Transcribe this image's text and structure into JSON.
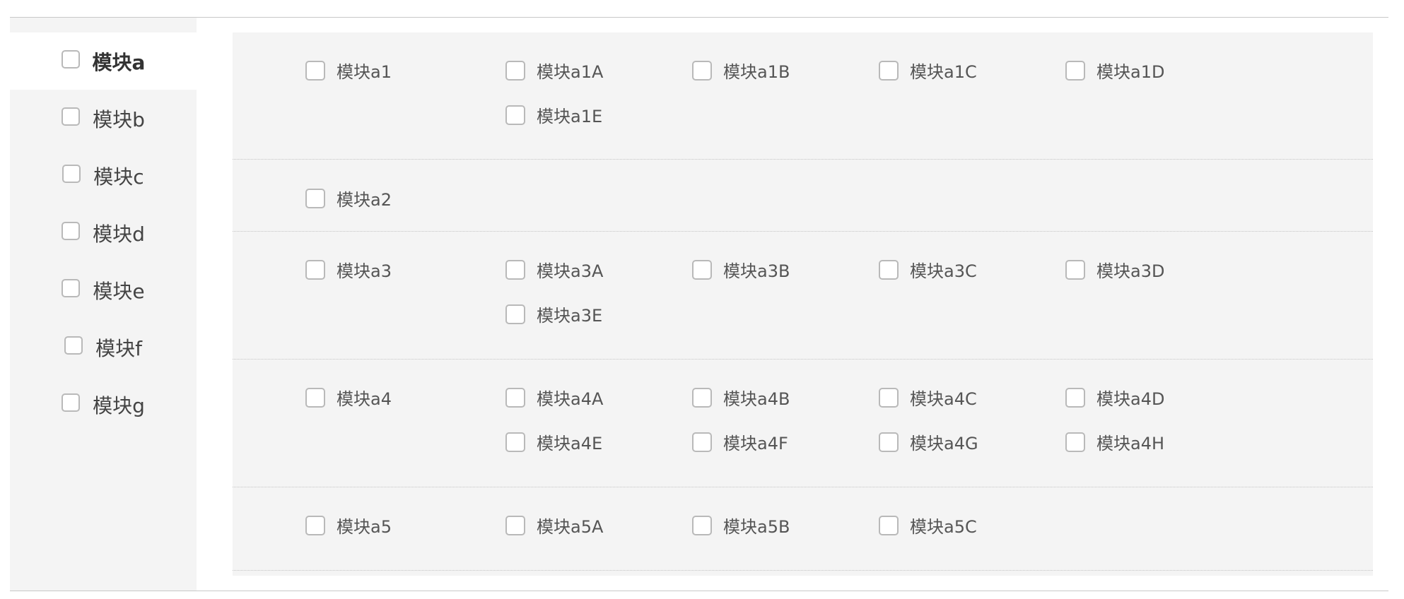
{
  "sidebar": {
    "items": [
      {
        "label": "模块a",
        "active": true
      },
      {
        "label": "模块b"
      },
      {
        "label": "模块c"
      },
      {
        "label": "模块d"
      },
      {
        "label": "模块e"
      },
      {
        "label": "模块f"
      },
      {
        "label": "模块g"
      }
    ]
  },
  "groups": [
    {
      "parent": "模块a1",
      "children": [
        "模块a1A",
        "模块a1B",
        "模块a1C",
        "模块a1D",
        "模块a1E"
      ]
    },
    {
      "parent": "模块a2",
      "children": []
    },
    {
      "parent": "模块a3",
      "children": [
        "模块a3A",
        "模块a3B",
        "模块a3C",
        "模块a3D",
        "模块a3E"
      ]
    },
    {
      "parent": "模块a4",
      "children": [
        "模块a4A",
        "模块a4B",
        "模块a4C",
        "模块a4D",
        "模块a4E",
        "模块a4F",
        "模块a4G",
        "模块a4H"
      ]
    },
    {
      "parent": "模块a5",
      "children": [
        "模块a5A",
        "模块a5B",
        "模块a5C"
      ]
    }
  ],
  "colors": {
    "panel_bg": "#f4f4f4",
    "checkbox_border": "#b9b9b9",
    "divider": "#c4c4c4"
  }
}
